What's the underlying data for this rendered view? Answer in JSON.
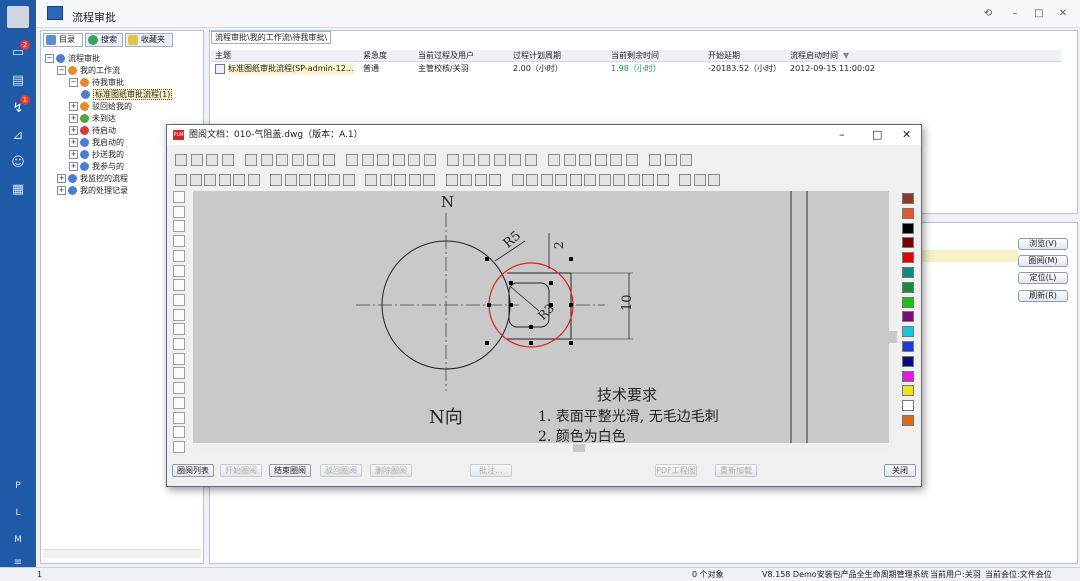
{
  "app": {
    "title": "流程审批",
    "badges": [
      "2",
      "1"
    ],
    "nav_letters": [
      "P",
      "L",
      "M",
      "≡"
    ]
  },
  "tabs": [
    "目录",
    "搜索",
    "收藏夹"
  ],
  "tree": [
    {
      "label": "流程审批",
      "lvl": 0,
      "tg": "−"
    },
    {
      "label": "我的工作流",
      "lvl": 1,
      "tg": "−"
    },
    {
      "label": "待我审批",
      "lvl": 2,
      "tg": "−"
    },
    {
      "label": "标准图纸审批流程(1)",
      "lvl": 3,
      "tg": "",
      "sel": true
    },
    {
      "label": "驳回给我的",
      "lvl": 2,
      "tg": "+"
    },
    {
      "label": "未到达",
      "lvl": 2,
      "tg": "+"
    },
    {
      "label": "待启动",
      "lvl": 2,
      "tg": "+"
    },
    {
      "label": "我启动的",
      "lvl": 2,
      "tg": "+"
    },
    {
      "label": "抄送我的",
      "lvl": 2,
      "tg": "+"
    },
    {
      "label": "我参与的",
      "lvl": 2,
      "tg": "+"
    },
    {
      "label": "我监控的流程",
      "lvl": 1,
      "tg": "+"
    },
    {
      "label": "我的处理记录",
      "lvl": 1,
      "tg": "+"
    }
  ],
  "breadcrumb": "流程审批\\我的工作流\\待我审批\\",
  "grid": {
    "headers": [
      "主题",
      "紧急度",
      "当前过程及用户",
      "过程计划周期",
      "当前剩余时间",
      "开始延期",
      "流程启动时间"
    ],
    "row": [
      "标准图纸审批流程(SP-admin-12...",
      "普通",
      "主管校核/关羽",
      "2.00（小时）",
      "1.98（小时）",
      "-20183.52（小时）",
      "2012-09-15 11:00:02"
    ]
  },
  "right_buttons": [
    "浏览(V)",
    "圈阅(M)",
    "定位(L)",
    "刷新(R)"
  ],
  "viewer": {
    "title": "圈阅文档：010-气阻盖.dwg（版本：A.1）",
    "logo": "PLM",
    "drawing": {
      "n_top": "N",
      "r5": "R5",
      "dim2": "2",
      "dim10": "10",
      "r3": "R3",
      "n_dir": "N向",
      "req_title": "技术要求",
      "req1": "1. 表面平整光滑, 无毛边毛刺",
      "req2": "2. 颜色为白色"
    },
    "buttons": [
      "圈阅列表",
      "开始圈阅",
      "结束圈阅",
      "驳回圈阅",
      "删除圈阅",
      "批注...",
      "PDF工程图",
      "重新加载",
      "关闭"
    ]
  },
  "status": {
    "left": "1",
    "objects": "0 个对象",
    "system": "V8.158 Demo安装包产品全生命周期管理系统",
    "user": "当前用户:关羽",
    "unit": "当前会位:文件会位"
  },
  "colors": {
    "nav": "#1f5aa8",
    "accent": "#2a67b8",
    "circle_red": "#e02020"
  }
}
